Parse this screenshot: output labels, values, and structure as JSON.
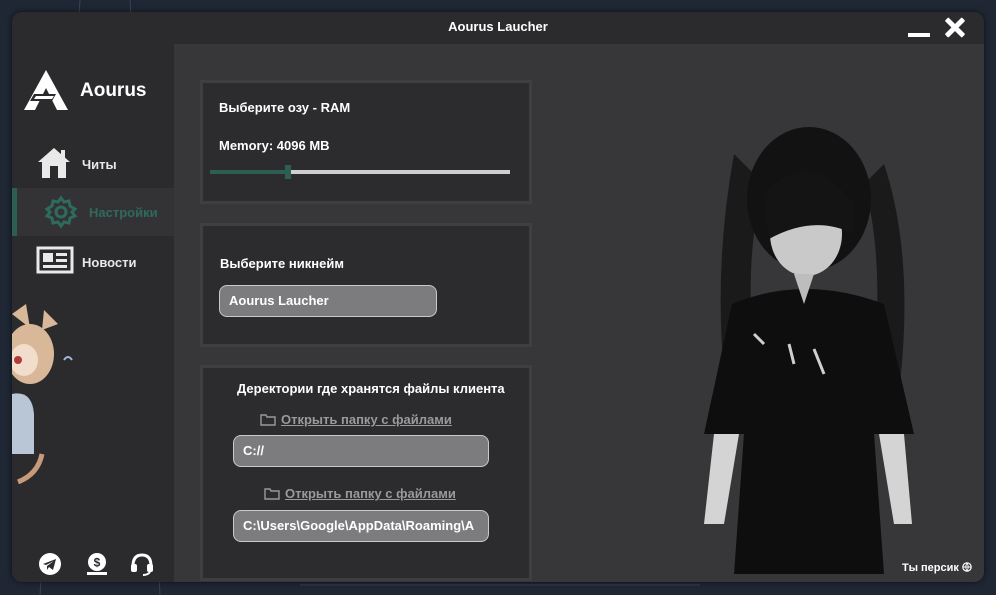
{
  "window": {
    "title": "Aourus Laucher"
  },
  "sidebar": {
    "logo_text": "Aourus",
    "items": [
      {
        "label": "Читы",
        "icon": "home-icon",
        "active": false
      },
      {
        "label": "Настройки",
        "icon": "gear-icon",
        "active": true
      },
      {
        "label": "Новости",
        "icon": "newspaper-icon",
        "active": false
      }
    ],
    "social": [
      {
        "icon": "telegram-icon"
      },
      {
        "icon": "donate-icon"
      },
      {
        "icon": "support-headset-icon"
      }
    ]
  },
  "settings": {
    "ram": {
      "title": "Выберите озу - RAM",
      "memory_label": "Memory: 4096 MB",
      "slider_fraction": 0.26
    },
    "nickname": {
      "title": "Выберите никнейм",
      "value": "Aourus Laucher"
    },
    "directories": {
      "title": "Деректории где хранятся файлы клиента",
      "link1": "Открыть папку с файлами",
      "path1": "C://",
      "link2": "Открыть папку с файлами",
      "path2": "C:\\Users\\Google\\AppData\\Roaming\\A"
    }
  },
  "character": {
    "label": "Ты персик"
  },
  "colors": {
    "accent": "#2e5d52",
    "window_bg": "#2b2b2d",
    "content_bg": "#373739",
    "panel_bg": "#2c2c2e"
  }
}
